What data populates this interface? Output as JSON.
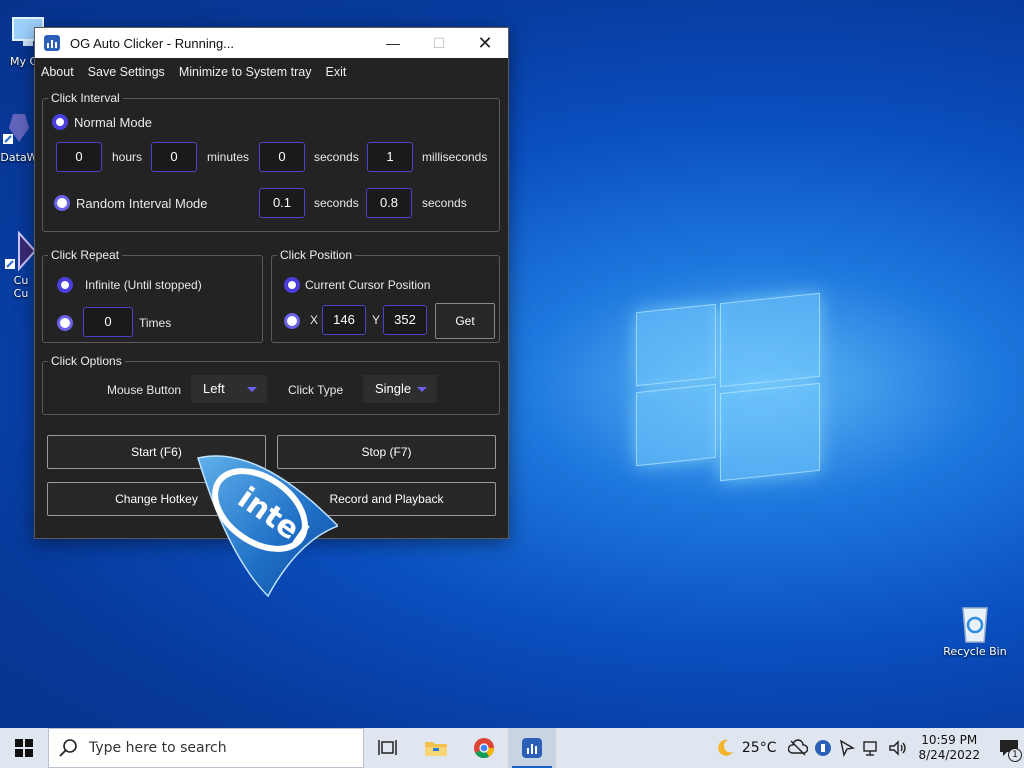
{
  "desktop": {
    "icons": [
      {
        "label": "My Co",
        "icon": "computer-icon"
      },
      {
        "label": "DataW",
        "icon": "app-shortcut-icon"
      },
      {
        "label": "Cu\nCu",
        "icon": "app-shortcut-icon"
      },
      {
        "label": "Recycle Bin",
        "icon": "recycle-bin-icon"
      }
    ]
  },
  "window": {
    "title": "OG Auto Clicker - Running...",
    "menu": [
      "About",
      "Save Settings",
      "Minimize to System tray",
      "Exit"
    ],
    "click_interval": {
      "label": "Click Interval",
      "normal_mode_label": "Normal Mode",
      "hours_value": "0",
      "hours_label": "hours",
      "minutes_value": "0",
      "minutes_label": "minutes",
      "seconds_value": "0",
      "seconds_label": "seconds",
      "ms_value": "1",
      "ms_label": "milliseconds",
      "random_mode_label": "Random Interval Mode",
      "random_min_value": "0.1",
      "random_min_label": "seconds",
      "random_max_value": "0.8",
      "random_max_label": "seconds"
    },
    "click_repeat": {
      "label": "Click Repeat",
      "infinite_label": "Infinite (Until stopped)",
      "times_value": "0",
      "times_label": "Times"
    },
    "click_position": {
      "label": "Click Position",
      "current_label": "Current Cursor Position",
      "x_label": "X",
      "x_value": "146",
      "y_label": "Y",
      "y_value": "352",
      "get_label": "Get"
    },
    "click_options": {
      "label": "Click Options",
      "mouse_button_label": "Mouse Button",
      "mouse_button_value": "Left",
      "click_type_label": "Click Type",
      "click_type_value": "Single"
    },
    "buttons": {
      "start": "Start (F6)",
      "stop": "Stop (F7)",
      "hotkey": "Change Hotkey",
      "record": "Record and Playback"
    }
  },
  "overlay": {
    "logo_text": "intel"
  },
  "taskbar": {
    "search_placeholder": "Type here to search",
    "weather": "25°C",
    "time": "10:59 PM",
    "date": "8/24/2022",
    "notification_count": "1"
  },
  "colors": {
    "accent": "#4a3fdc",
    "window_bg": "#232323",
    "taskbar_bg": "#dfe6ef"
  }
}
